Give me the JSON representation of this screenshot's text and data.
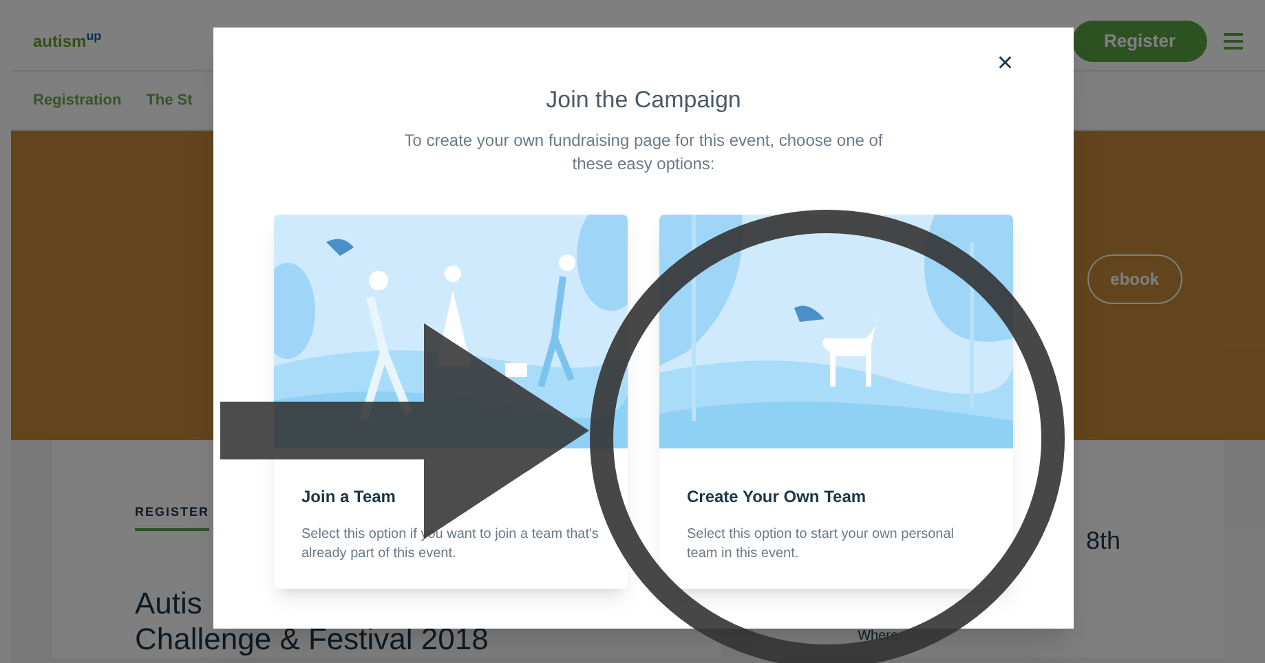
{
  "header": {
    "logo": "autism",
    "logo_sup": "up",
    "register_button": "Register"
  },
  "nav": {
    "items": [
      {
        "label": "Registration"
      },
      {
        "label": "The St"
      }
    ]
  },
  "hero": {
    "button_partial": "ebook"
  },
  "event_card": {
    "eyebrow": "REGISTER",
    "title_line_1": "Autis",
    "title_line_2": "Challenge & Festival 2018"
  },
  "side_card": {
    "date_partial": "8th",
    "where_label": "Where"
  },
  "modal": {
    "title": "Join the Campaign",
    "subtitle": "To create your own fundraising page for this event, choose one of these easy options:",
    "close": "×",
    "options": [
      {
        "kind": "join",
        "title": "Join a Team",
        "description": "Select this option if you want to join a team that's already part of this event."
      },
      {
        "kind": "create",
        "title": "Create Your Own Team",
        "description": "Select this option to start your own personal team in this event."
      }
    ]
  }
}
